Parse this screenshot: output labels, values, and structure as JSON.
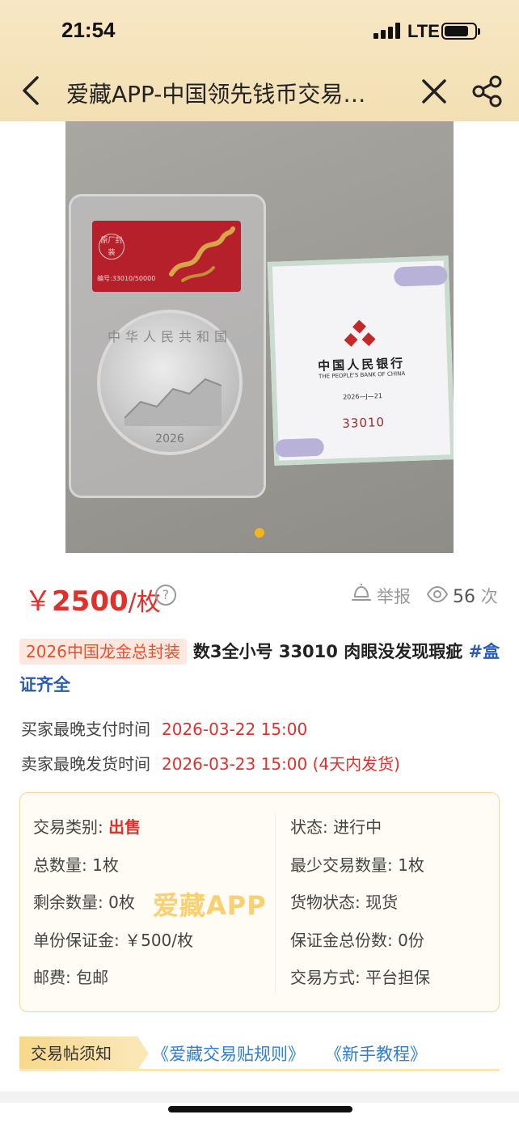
{
  "status_bar": {
    "time": "21:54",
    "network": "LTE"
  },
  "nav": {
    "title": "爱藏APP-中国领先钱币交易…"
  },
  "photo": {
    "label_seal": "原厂封装",
    "label_serial": "编号:33010/50000",
    "coin_legend": "中华人民共和国",
    "coin_year": "2026",
    "cert_bank_cn": "中国人民银行",
    "cert_bank_en": "THE PEOPLE'S BANK OF CHINA",
    "cert_date": "2026—J—21",
    "cert_number": "33010",
    "accent_color": "#f2b51c"
  },
  "price": {
    "currency": "￥",
    "amount": "2500",
    "unit": "/枚"
  },
  "stats": {
    "report_label": "举报",
    "views_count": "56",
    "views_unit": "次"
  },
  "listing": {
    "tag": "2026中国龙金总封装",
    "title": "数3全小号 33010 肉眼没发现瑕疵",
    "hashtag": "#盒证齐全"
  },
  "deadlines": {
    "buyer_label": "买家最晚支付时间",
    "buyer_value": "2026-03-22 15:00",
    "seller_label": "卖家最晚发货时间",
    "seller_value": "2026-03-23 15:00 (4天内发货)"
  },
  "details": {
    "left": [
      {
        "label": "交易类别: ",
        "value": "出售"
      },
      {
        "label": "总数量: 1枚",
        "value": ""
      },
      {
        "label": "剩余数量: 0枚",
        "value": ""
      },
      {
        "label": "单份保证金: ￥500/枚",
        "value": ""
      },
      {
        "label": "邮费: 包邮",
        "value": ""
      }
    ],
    "right": [
      {
        "label": "状态: 进行中"
      },
      {
        "label": "最少交易数量: 1枚"
      },
      {
        "label": "货物状态: 现货"
      },
      {
        "label": "保证金总份数: 0份"
      },
      {
        "label": "交易方式: 平台担保"
      }
    ],
    "watermark": "爱藏APP"
  },
  "notice": {
    "tag": "交易帖须知",
    "link1": "《爱藏交易贴规则》",
    "link2": "《新手教程》"
  },
  "colors": {
    "price_red": "#e0302c",
    "link_blue": "#2f7fd8",
    "header_gold": "#f3dfb3"
  }
}
